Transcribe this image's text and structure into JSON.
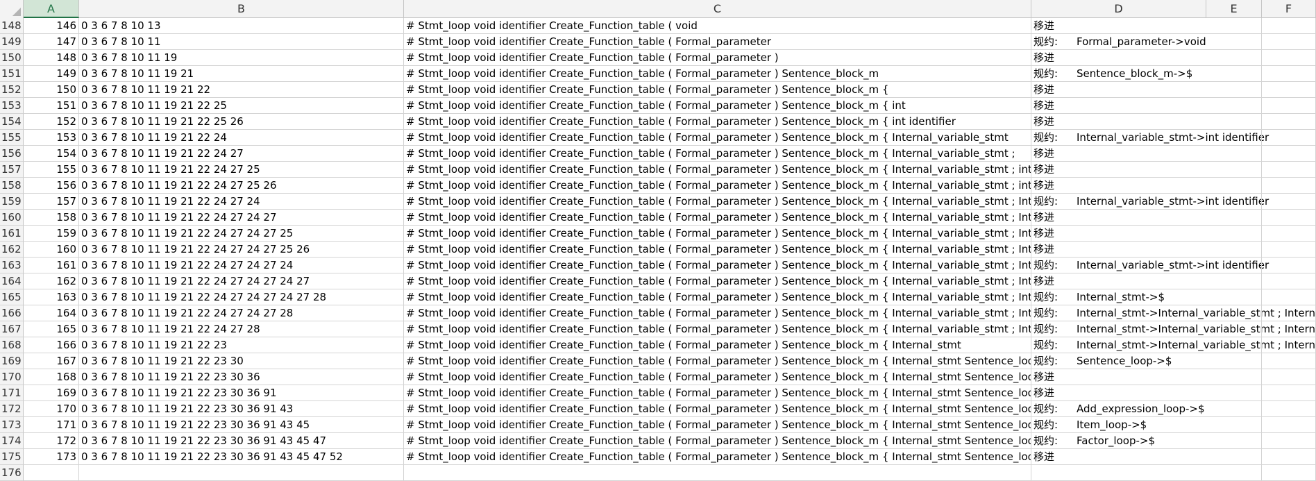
{
  "columns": [
    "A",
    "B",
    "C",
    "D",
    "E",
    "F"
  ],
  "rows": [
    {
      "r": "148",
      "a": "146",
      "b": "0 3 6 7 8 10 13",
      "c": "# Stmt_loop void identifier Create_Function_table ( void",
      "d1": "移进",
      "d2": ""
    },
    {
      "r": "149",
      "a": "147",
      "b": "0 3 6 7 8 10 11",
      "c": "# Stmt_loop void identifier Create_Function_table ( Formal_parameter",
      "d1": "规约:",
      "d2": "Formal_parameter->void"
    },
    {
      "r": "150",
      "a": "148",
      "b": "0 3 6 7 8 10 11 19",
      "c": "# Stmt_loop void identifier Create_Function_table ( Formal_parameter )",
      "d1": "移进",
      "d2": ""
    },
    {
      "r": "151",
      "a": "149",
      "b": "0 3 6 7 8 10 11 19 21",
      "c": "# Stmt_loop void identifier Create_Function_table ( Formal_parameter ) Sentence_block_m",
      "d1": "规约:",
      "d2": "Sentence_block_m->$"
    },
    {
      "r": "152",
      "a": "150",
      "b": "0 3 6 7 8 10 11 19 21 22",
      "c": "# Stmt_loop void identifier Create_Function_table ( Formal_parameter ) Sentence_block_m {",
      "d1": "移进",
      "d2": ""
    },
    {
      "r": "153",
      "a": "151",
      "b": "0 3 6 7 8 10 11 19 21 22 25",
      "c": "# Stmt_loop void identifier Create_Function_table ( Formal_parameter ) Sentence_block_m { int",
      "d1": "移进",
      "d2": ""
    },
    {
      "r": "154",
      "a": "152",
      "b": "0 3 6 7 8 10 11 19 21 22 25 26",
      "c": "# Stmt_loop void identifier Create_Function_table ( Formal_parameter ) Sentence_block_m { int identifier",
      "d1": "移进",
      "d2": ""
    },
    {
      "r": "155",
      "a": "153",
      "b": "0 3 6 7 8 10 11 19 21 22 24",
      "c": "# Stmt_loop void identifier Create_Function_table ( Formal_parameter ) Sentence_block_m { Internal_variable_stmt",
      "d1": "规约:",
      "d2": "Internal_variable_stmt->int identifier"
    },
    {
      "r": "156",
      "a": "154",
      "b": "0 3 6 7 8 10 11 19 21 22 24 27",
      "c": "# Stmt_loop void identifier Create_Function_table ( Formal_parameter ) Sentence_block_m { Internal_variable_stmt ;",
      "d1": "移进",
      "d2": ""
    },
    {
      "r": "157",
      "a": "155",
      "b": "0 3 6 7 8 10 11 19 21 22 24 27 25",
      "c": "# Stmt_loop void identifier Create_Function_table ( Formal_parameter ) Sentence_block_m { Internal_variable_stmt ; int",
      "d1": "移进",
      "d2": ""
    },
    {
      "r": "158",
      "a": "156",
      "b": "0 3 6 7 8 10 11 19 21 22 24 27 25 26",
      "c": "# Stmt_loop void identifier Create_Function_table ( Formal_parameter ) Sentence_block_m { Internal_variable_stmt ; int",
      "d1": "移进",
      "d2": ""
    },
    {
      "r": "159",
      "a": "157",
      "b": "0 3 6 7 8 10 11 19 21 22 24 27 24",
      "c": "# Stmt_loop void identifier Create_Function_table ( Formal_parameter ) Sentence_block_m { Internal_variable_stmt ; Int",
      "d1": "规约:",
      "d2": "Internal_variable_stmt->int identifier"
    },
    {
      "r": "160",
      "a": "158",
      "b": "0 3 6 7 8 10 11 19 21 22 24 27 24 27",
      "c": "# Stmt_loop void identifier Create_Function_table ( Formal_parameter ) Sentence_block_m { Internal_variable_stmt ; Int",
      "d1": "移进",
      "d2": ""
    },
    {
      "r": "161",
      "a": "159",
      "b": "0 3 6 7 8 10 11 19 21 22 24 27 24 27 25",
      "c": "# Stmt_loop void identifier Create_Function_table ( Formal_parameter ) Sentence_block_m { Internal_variable_stmt ; Int",
      "d1": "移进",
      "d2": ""
    },
    {
      "r": "162",
      "a": "160",
      "b": "0 3 6 7 8 10 11 19 21 22 24 27 24 27 25 26",
      "c": "# Stmt_loop void identifier Create_Function_table ( Formal_parameter ) Sentence_block_m { Internal_variable_stmt ; Int",
      "d1": "移进",
      "d2": ""
    },
    {
      "r": "163",
      "a": "161",
      "b": "0 3 6 7 8 10 11 19 21 22 24 27 24 27 24",
      "c": "# Stmt_loop void identifier Create_Function_table ( Formal_parameter ) Sentence_block_m { Internal_variable_stmt ; Int",
      "d1": "规约:",
      "d2": "Internal_variable_stmt->int identifier"
    },
    {
      "r": "164",
      "a": "162",
      "b": "0 3 6 7 8 10 11 19 21 22 24 27 24 27 24 27",
      "c": "# Stmt_loop void identifier Create_Function_table ( Formal_parameter ) Sentence_block_m { Internal_variable_stmt ; Int",
      "d1": "移进",
      "d2": ""
    },
    {
      "r": "165",
      "a": "163",
      "b": "0 3 6 7 8 10 11 19 21 22 24 27 24 27 24 27 28",
      "c": "# Stmt_loop void identifier Create_Function_table ( Formal_parameter ) Sentence_block_m { Internal_variable_stmt ; Int",
      "d1": "规约:",
      "d2": "Internal_stmt->$"
    },
    {
      "r": "166",
      "a": "164",
      "b": "0 3 6 7 8 10 11 19 21 22 24 27 24 27 28",
      "c": "# Stmt_loop void identifier Create_Function_table ( Formal_parameter ) Sentence_block_m { Internal_variable_stmt ; Int",
      "d1": "规约:",
      "d2": "Internal_stmt->Internal_variable_stmt ; Interna"
    },
    {
      "r": "167",
      "a": "165",
      "b": "0 3 6 7 8 10 11 19 21 22 24 27 28",
      "c": "# Stmt_loop void identifier Create_Function_table ( Formal_parameter ) Sentence_block_m { Internal_variable_stmt ; Int",
      "d1": "规约:",
      "d2": "Internal_stmt->Internal_variable_stmt ; Interna"
    },
    {
      "r": "168",
      "a": "166",
      "b": "0 3 6 7 8 10 11 19 21 22 23",
      "c": "# Stmt_loop void identifier Create_Function_table ( Formal_parameter ) Sentence_block_m { Internal_stmt",
      "d1": "规约:",
      "d2": "Internal_stmt->Internal_variable_stmt ; Interna"
    },
    {
      "r": "169",
      "a": "167",
      "b": "0 3 6 7 8 10 11 19 21 22 23 30",
      "c": "# Stmt_loop void identifier Create_Function_table ( Formal_parameter ) Sentence_block_m { Internal_stmt Sentence_loo",
      "d1": "规约:",
      "d2": "Sentence_loop->$"
    },
    {
      "r": "170",
      "a": "168",
      "b": "0 3 6 7 8 10 11 19 21 22 23 30 36",
      "c": "# Stmt_loop void identifier Create_Function_table ( Formal_parameter ) Sentence_block_m { Internal_stmt Sentence_loo",
      "d1": "移进",
      "d2": ""
    },
    {
      "r": "171",
      "a": "169",
      "b": "0 3 6 7 8 10 11 19 21 22 23 30 36 91",
      "c": "# Stmt_loop void identifier Create_Function_table ( Formal_parameter ) Sentence_block_m { Internal_stmt Sentence_loo",
      "d1": "移进",
      "d2": ""
    },
    {
      "r": "172",
      "a": "170",
      "b": "0 3 6 7 8 10 11 19 21 22 23 30 36 91 43",
      "c": "# Stmt_loop void identifier Create_Function_table ( Formal_parameter ) Sentence_block_m { Internal_stmt Sentence_loo",
      "d1": "规约:",
      "d2": "Add_expression_loop->$"
    },
    {
      "r": "173",
      "a": "171",
      "b": "0 3 6 7 8 10 11 19 21 22 23 30 36 91 43 45",
      "c": "# Stmt_loop void identifier Create_Function_table ( Formal_parameter ) Sentence_block_m { Internal_stmt Sentence_loo",
      "d1": "规约:",
      "d2": "Item_loop->$"
    },
    {
      "r": "174",
      "a": "172",
      "b": "0 3 6 7 8 10 11 19 21 22 23 30 36 91 43 45 47",
      "c": "# Stmt_loop void identifier Create_Function_table ( Formal_parameter ) Sentence_block_m { Internal_stmt Sentence_loo",
      "d1": "规约:",
      "d2": "Factor_loop->$"
    },
    {
      "r": "175",
      "a": "173",
      "b": "0 3 6 7 8 10 11 19 21 22 23 30 36 91 43 45 47 52",
      "c": "# Stmt_loop void identifier Create_Function_table ( Formal_parameter ) Sentence_block_m { Internal_stmt Sentence_loo",
      "d1": "移进",
      "d2": ""
    },
    {
      "r": "176",
      "a": "",
      "b": "",
      "c": "",
      "d1": "",
      "d2": ""
    }
  ]
}
